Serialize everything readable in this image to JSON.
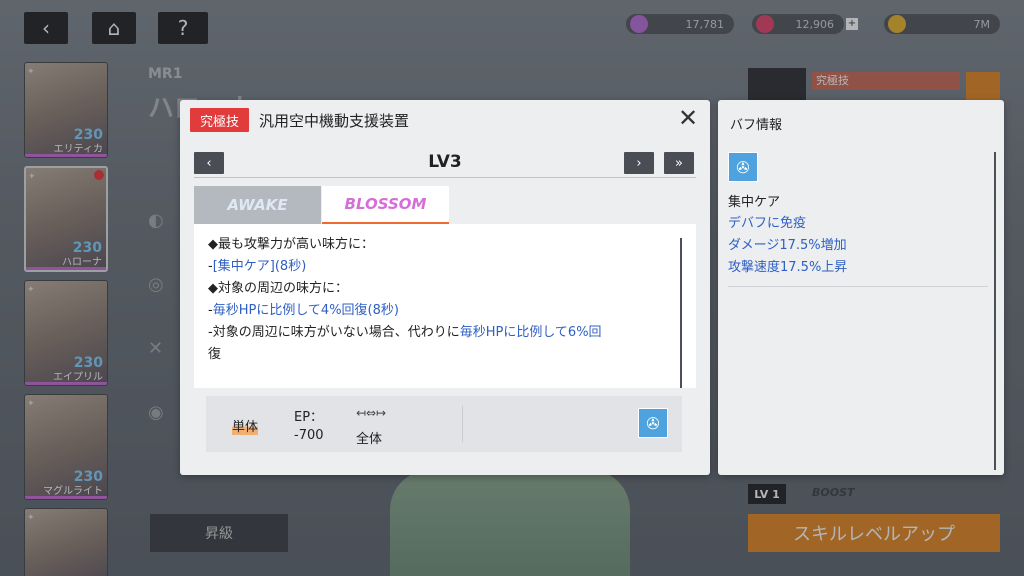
{
  "resources": [
    {
      "icon": "crystal-icon",
      "value": "17,781",
      "color": "#b66ad6"
    },
    {
      "icon": "gem-icon",
      "value": "12,906",
      "color": "#e0406a"
    },
    {
      "icon": "coin-icon",
      "value": "7M",
      "color": "#e8b22a"
    }
  ],
  "background": {
    "mr_tag": "MR1",
    "char_name": "ハローナ",
    "upgrade_label": "昇級",
    "skill_level_up_label": "スキルレベルアップ",
    "lv_badge": "LV 1",
    "boost_label": "BOOST",
    "ult_tag": "究極技",
    "characters": [
      {
        "name": "エリティカ",
        "level": "230"
      },
      {
        "name": "ハローナ",
        "level": "230"
      },
      {
        "name": "エイプリル",
        "level": "230"
      },
      {
        "name": "マグルライト",
        "level": "230"
      },
      {
        "name": "",
        "level": ""
      }
    ]
  },
  "skill_dialog": {
    "ult_tag": "究極技",
    "skill_name": "汎用空中機動支援装置",
    "level": "LV3",
    "tabs": [
      "AWAKE",
      "BLOSSOM"
    ],
    "selected_tab": "BLOSSOM",
    "description": {
      "line1": "◆最も攻撃力が高い味方に：",
      "line2_prefix": "-",
      "line2_blue": "[集中ケア](8秒)",
      "line3": "◆対象の周辺の味方に：",
      "line4_prefix": "-",
      "line4_blue": "毎秒HPに比例して4%回復(8秒)",
      "line5_prefix": "-対象の周辺に味方がいない場合、代わりに",
      "line5_blue": "毎秒HPに比例して6%回",
      "line6_blue": "復"
    },
    "target": "単体",
    "ep_label": "EP：",
    "ep_value": "-700",
    "range_icon": "↤⇔↦",
    "range_value": "全体"
  },
  "buff_panel": {
    "title": "バフ情報",
    "buff_name": "集中ケア",
    "effects": [
      "デバフに免疫",
      "ダメージ17.5%増加",
      "攻撃速度17.5%上昇"
    ]
  }
}
